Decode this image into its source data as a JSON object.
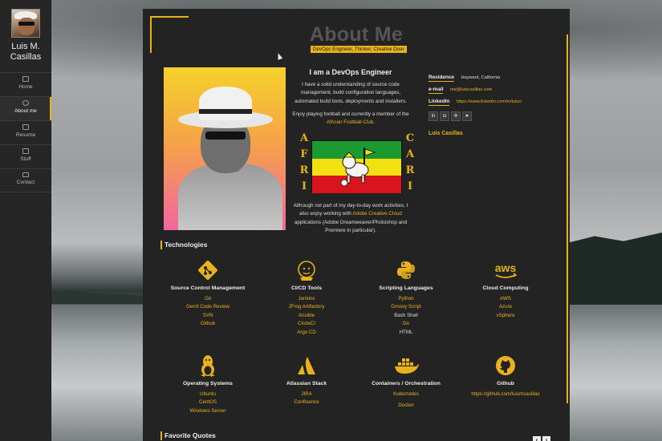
{
  "sidebar": {
    "name": "Luis M. Casillas",
    "items": [
      {
        "label": "Home",
        "icon": "home-icon",
        "active": false
      },
      {
        "label": "About me",
        "icon": "user-circle-icon",
        "active": true
      },
      {
        "label": "Resume",
        "icon": "calendar-icon",
        "active": false
      },
      {
        "label": "Stuff",
        "icon": "briefcase-icon",
        "active": false
      },
      {
        "label": "Contact",
        "icon": "envelope-icon",
        "active": false
      }
    ]
  },
  "page": {
    "title": "About Me",
    "subtitle": "DevOps Engineer, Thinker, Creative Doer"
  },
  "intro": {
    "heading": "I am a DevOps Engineer",
    "p1": "I have a solid understanding of source code management, build configuration languages, automated build tools, deployments and installers.",
    "p2_pre": "Enjoy playing football and currently a member of the",
    "p2_link": "African Football Club",
    "p3_pre": "Although not part of my day-to-day work activities, I also enjoy working with",
    "p3_link": "Adobe Creative Cloud",
    "p3_post": "applications (Adobe Dreamweaver/Photoshop and Premiere in particular).",
    "flag_left": [
      "A",
      "F",
      "R",
      "I"
    ],
    "flag_right": [
      "C",
      "A",
      "R",
      "I"
    ]
  },
  "contact": {
    "residence_label": "Residence",
    "residence_value": "Hayward, California",
    "email_label": "e-mail",
    "email_value": "me@luiscasillas.com",
    "linkedin_label": "LinkedIn",
    "linkedin_value": "https://www.linkedin.com/in/luisc/",
    "socials": [
      "linkedin-icon",
      "instagram-icon",
      "slack-icon",
      "telegram-icon"
    ],
    "social_glyphs": [
      "in",
      "◘",
      "✣",
      "➤"
    ],
    "handle": "Luis Casillas"
  },
  "technologies": {
    "heading": "Technologies",
    "groups": [
      {
        "name": "Source Control Management",
        "icon": "git-icon",
        "items": [
          "Git",
          "Gerrit Code Review",
          "SVN",
          "Github"
        ]
      },
      {
        "name": "CI/CD Tools",
        "icon": "jenkins-icon",
        "items": [
          "Jenkins",
          "JFrog Artifactory",
          "Ansible",
          "CircleCI",
          "Argo CD"
        ]
      },
      {
        "name": "Scripting Languages",
        "icon": "python-icon",
        "items": [
          "Python",
          "Groovy Script",
          "Bash Shell",
          "Go",
          "HTML"
        ]
      },
      {
        "name": "Cloud Computing",
        "icon": "aws-icon",
        "items": [
          "AWS",
          "Azure",
          "vSphere"
        ]
      },
      {
        "name": "Operating Systems",
        "icon": "linux-icon",
        "items": [
          "Ubuntu",
          "CentOS",
          "Windows Server"
        ]
      },
      {
        "name": "Atlassian Stack",
        "icon": "atlassian-icon",
        "items": [
          "JIRA",
          "Confluence"
        ]
      },
      {
        "name": "Containers / Orchestration",
        "icon": "docker-icon",
        "items": [
          "Kubernetes",
          "Docker"
        ]
      },
      {
        "name": "Github",
        "icon": "github-icon",
        "items": [
          "https://github.com/luismcasillas"
        ]
      }
    ],
    "white_items": [
      "Bash Shell",
      "HTML"
    ]
  },
  "quotes": {
    "heading": "Favorite Quotes",
    "prev": "‹",
    "next": "›"
  },
  "colors": {
    "accent": "#e8b21c",
    "panel": "#232323",
    "sidebar": "#262626"
  }
}
